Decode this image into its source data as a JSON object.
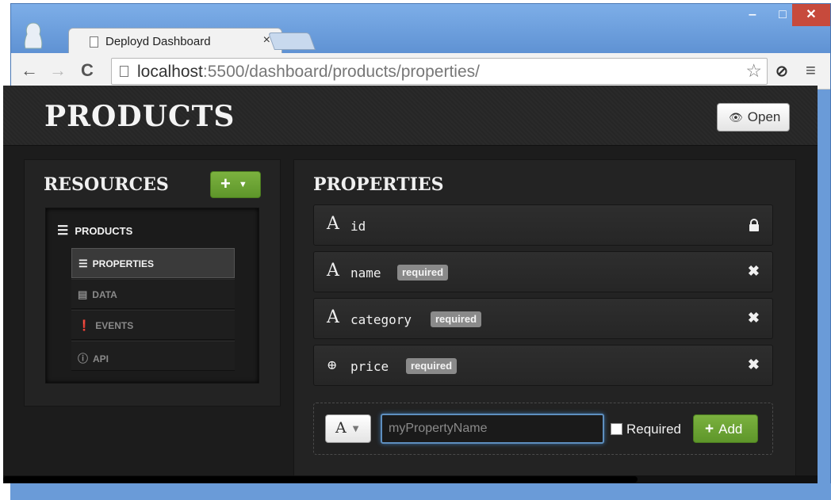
{
  "browser": {
    "tab_title": "Deployd Dashboard",
    "tab_close": "×",
    "window_controls": {
      "minimize": "‒",
      "maximize": "□",
      "close": "✕"
    },
    "url_host": "localhost",
    "url_path": ":5500/dashboard/products/properties/"
  },
  "header": {
    "title": "PRODUCTS",
    "open_button": "Open"
  },
  "resources": {
    "title": "RESOURCES",
    "add_button": "+",
    "root_item": "PRODUCTS",
    "sub_items": [
      {
        "label": "PROPERTIES",
        "icon": "list-icon",
        "active": true
      },
      {
        "label": "DATA",
        "icon": "table-icon",
        "active": false
      },
      {
        "label": "EVENTS",
        "icon": "exclamation-circle-icon",
        "active": false
      },
      {
        "label": "API",
        "icon": "info-circle-icon",
        "active": false
      }
    ]
  },
  "properties": {
    "title": "PROPERTIES",
    "rows": [
      {
        "type": "A",
        "name": "id",
        "badge": "",
        "action": "lock-icon"
      },
      {
        "type": "A",
        "name": "name",
        "badge": "required",
        "action": "remove-icon"
      },
      {
        "type": "A",
        "name": "category",
        "badge": "required",
        "action": "remove-icon"
      },
      {
        "type": "plus-circle",
        "name": "price",
        "badge": "required",
        "action": "remove-icon"
      }
    ],
    "add_form": {
      "type_value": "A",
      "name_placeholder": "myPropertyName",
      "required_label": "Required",
      "add_button": "Add"
    }
  },
  "colors": {
    "accent_green": "#6ba533",
    "page_bg": "#1c1c1c",
    "badge_bg": "#8a8a8a",
    "input_focus": "#5e8fbf"
  }
}
